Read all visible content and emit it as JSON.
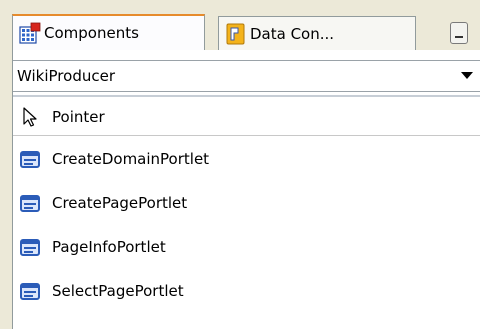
{
  "tabs": [
    {
      "label": "Components",
      "icon": "components-grid-icon",
      "active": true
    },
    {
      "label": "Data Con...",
      "icon": "data-control-icon",
      "active": false
    }
  ],
  "palette": {
    "page_selector": {
      "value": "WikiProducer"
    },
    "pointer_label": "Pointer",
    "items": [
      {
        "label": "CreateDomainPortlet",
        "icon": "portlet-icon"
      },
      {
        "label": "CreatePagePortlet",
        "icon": "portlet-icon"
      },
      {
        "label": "PageInfoPortlet",
        "icon": "portlet-icon"
      },
      {
        "label": "SelectPagePortlet",
        "icon": "portlet-icon"
      }
    ]
  },
  "colors": {
    "active_tab_accent": "#e68b2c",
    "portlet_icon": "#2b5cb8",
    "background": "#ece9d8"
  }
}
